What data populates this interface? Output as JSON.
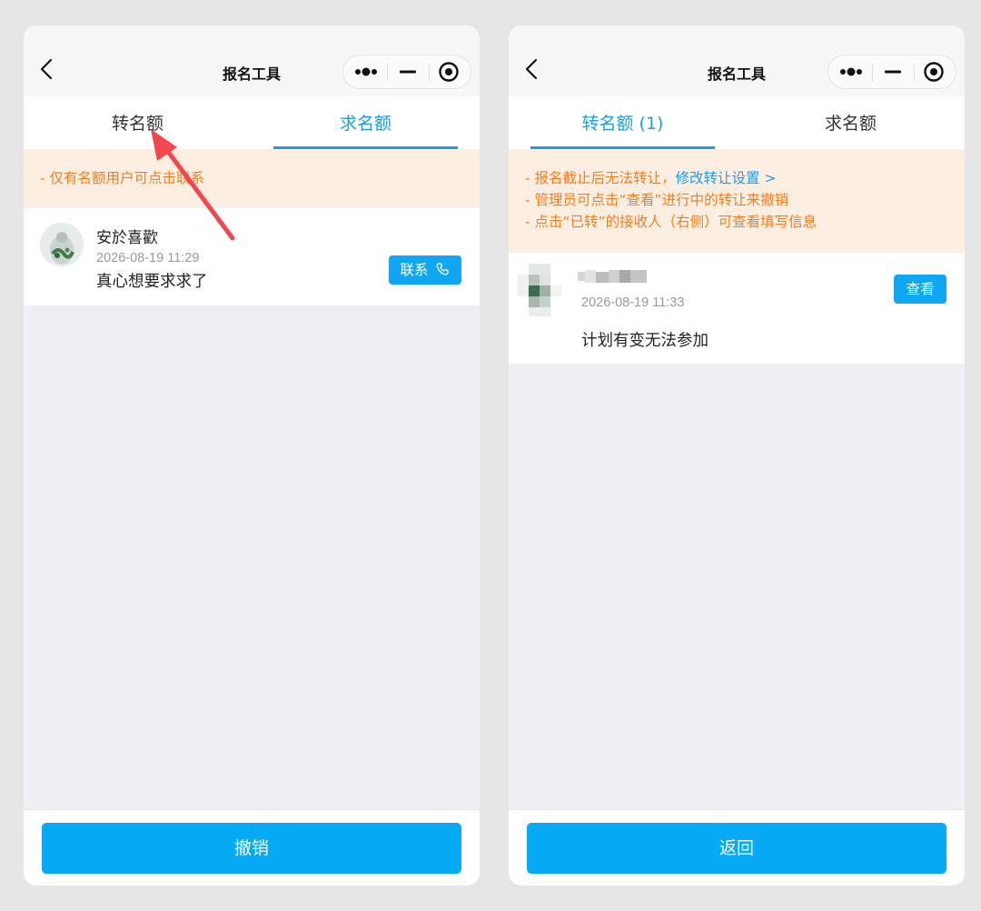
{
  "left": {
    "nav": {
      "title": "报名工具"
    },
    "tabs": [
      {
        "label": "转名额"
      },
      {
        "label": "求名额"
      }
    ],
    "notice": {
      "line1": "- 仅有名额用户可点击联系"
    },
    "item": {
      "name": "安於喜歡",
      "time": "2026-08-19 11:29",
      "message": "真心想要求求了",
      "button_label": "联系"
    },
    "footer_button": "撤销"
  },
  "right": {
    "nav": {
      "title": "报名工具"
    },
    "tabs": [
      {
        "label": "转名额 (1)"
      },
      {
        "label": "求名额"
      }
    ],
    "notice": {
      "line1_text": "- 报名截止后无法转让，",
      "line1_link": "修改转让设置 >",
      "line2": "- 管理员可点击“查看”进行中的转让来撤销",
      "line3": "- 点击“已转”的接收人（右侧）可查看填写信息"
    },
    "item": {
      "time": "2026-08-19 11:33",
      "message": "计划有变无法参加",
      "button_label": "查看"
    },
    "footer_button": "返回"
  },
  "colors": {
    "accent": "#1c9de8",
    "button": "#07aaf4",
    "notice_bg": "#fdeee2",
    "notice_text": "#f07f1f",
    "annotation_arrow": "#f0484e"
  },
  "icons": [
    "chevron-left-icon",
    "more-dots-icon",
    "minimize-icon",
    "target-close-icon",
    "phone-icon",
    "annotation-arrow"
  ]
}
